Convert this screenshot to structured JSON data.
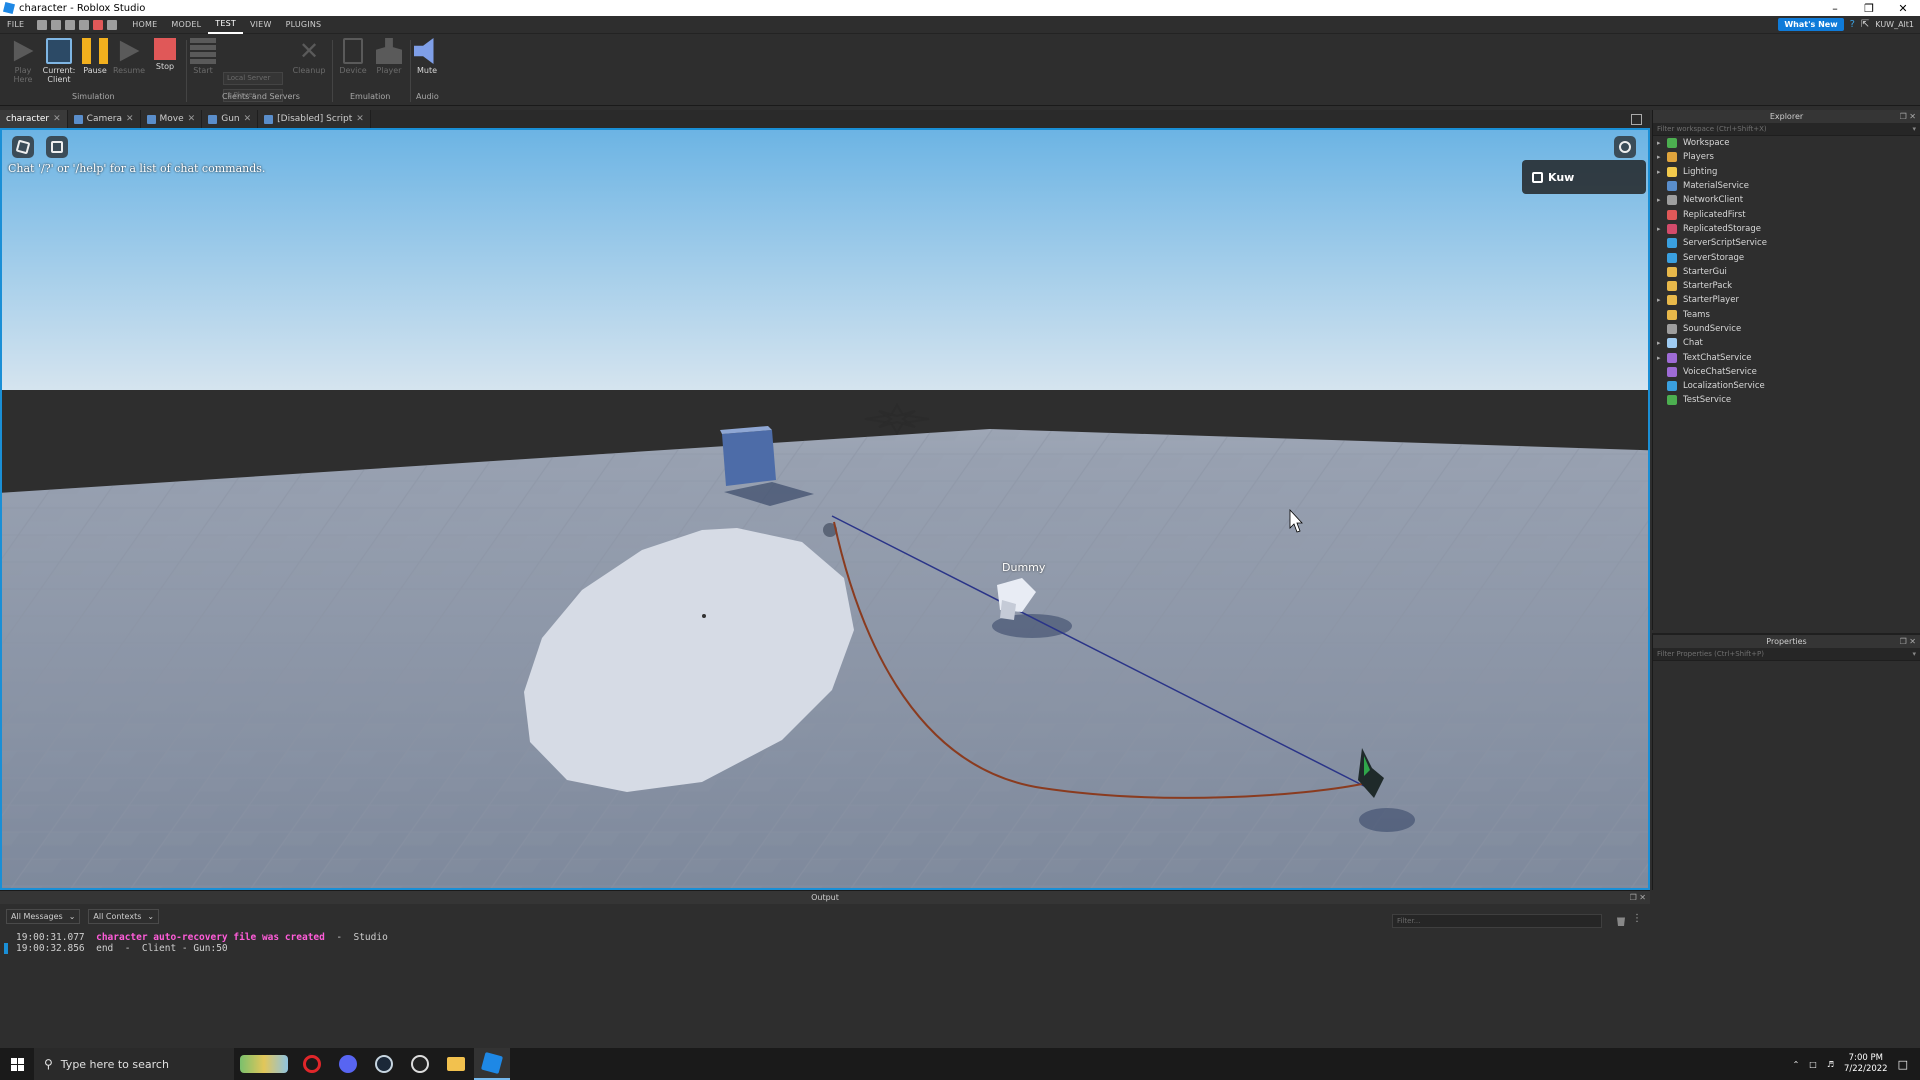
{
  "window": {
    "title": "character - Roblox Studio",
    "controls": [
      "–",
      "❐",
      "✕"
    ]
  },
  "menu": {
    "items": [
      "FILE",
      "HOME",
      "MODEL",
      "TEST",
      "VIEW",
      "PLUGINS"
    ],
    "active": "TEST",
    "whats_new": "What's New",
    "user": "KUW_Alt1"
  },
  "ribbon": {
    "play_here": "Play Here",
    "current_client": "Current: Client",
    "pause": "Pause",
    "resume": "Resume",
    "stop": "Stop",
    "start": "Start",
    "local_server": "Local Server",
    "player_count": "1 Player",
    "cleanup": "Cleanup",
    "device": "Device",
    "player": "Player",
    "mute": "Mute",
    "groups": [
      "Simulation",
      "Clients and Servers",
      "Emulation",
      "Audio"
    ]
  },
  "tabs": [
    {
      "label": "character"
    },
    {
      "label": "Camera"
    },
    {
      "label": "Move"
    },
    {
      "label": "Gun"
    },
    {
      "label": "[Disabled] Script"
    }
  ],
  "viewport": {
    "chat_hint": "Chat '/?' or '/help' for a list of chat commands.",
    "player_name": "Kuw",
    "dummy_label": "Dummy"
  },
  "explorer": {
    "title": "Explorer",
    "filter_placeholder": "Filter workspace (Ctrl+Shift+X)",
    "items": [
      {
        "label": "Workspace",
        "expandable": true,
        "icon": "globe-icon",
        "color": "#4caf50"
      },
      {
        "label": "Players",
        "expandable": true,
        "icon": "players-icon",
        "color": "#e0a43c"
      },
      {
        "label": "Lighting",
        "expandable": true,
        "icon": "bulb-icon",
        "color": "#f2c94c"
      },
      {
        "label": "MaterialService",
        "expandable": false,
        "icon": "material-icon",
        "color": "#5a8ecb"
      },
      {
        "label": "NetworkClient",
        "expandable": true,
        "icon": "network-icon",
        "color": "#9e9e9e"
      },
      {
        "label": "ReplicatedFirst",
        "expandable": false,
        "icon": "replicated-first-icon",
        "color": "#e05858"
      },
      {
        "label": "ReplicatedStorage",
        "expandable": true,
        "icon": "replicated-storage-icon",
        "color": "#d34b6b"
      },
      {
        "label": "ServerScriptService",
        "expandable": false,
        "icon": "server-script-icon",
        "color": "#3aa0e0"
      },
      {
        "label": "ServerStorage",
        "expandable": false,
        "icon": "server-storage-icon",
        "color": "#3aa0e0"
      },
      {
        "label": "StarterGui",
        "expandable": false,
        "icon": "folder-icon",
        "color": "#e8b84a"
      },
      {
        "label": "StarterPack",
        "expandable": false,
        "icon": "folder-icon",
        "color": "#e8b84a"
      },
      {
        "label": "StarterPlayer",
        "expandable": true,
        "icon": "folder-icon",
        "color": "#e8b84a"
      },
      {
        "label": "Teams",
        "expandable": false,
        "icon": "flag-icon",
        "color": "#e8b84a"
      },
      {
        "label": "SoundService",
        "expandable": false,
        "icon": "speaker-icon",
        "color": "#9e9e9e"
      },
      {
        "label": "Chat",
        "expandable": true,
        "icon": "chat-icon",
        "color": "#9ecbf2"
      },
      {
        "label": "TextChatService",
        "expandable": true,
        "icon": "text-chat-icon",
        "color": "#9e6bd6"
      },
      {
        "label": "VoiceChatService",
        "expandable": false,
        "icon": "voice-chat-icon",
        "color": "#9e6bd6"
      },
      {
        "label": "LocalizationService",
        "expandable": false,
        "icon": "localization-icon",
        "color": "#3aa0e0"
      },
      {
        "label": "TestService",
        "expandable": false,
        "icon": "check-icon",
        "color": "#4caf50"
      }
    ]
  },
  "properties": {
    "title": "Properties",
    "filter_placeholder": "Filter Properties (Ctrl+Shift+P)"
  },
  "output": {
    "title": "Output",
    "messages_filter": "All Messages",
    "contexts_filter": "All Contexts",
    "filter_placeholder": "Filter...",
    "lines": [
      {
        "time": "19:00:31.077",
        "message": "character auto-recovery file was created",
        "source": "  -  Studio"
      },
      {
        "time": "19:00:32.856",
        "message": "end",
        "source": "  -  Client - Gun:50"
      }
    ]
  },
  "taskbar": {
    "search_placeholder": "Type here to search",
    "time": "7:00 PM",
    "date": "7/22/2022"
  },
  "colors": {
    "accent": "#1a8fd6",
    "sky_top": "#6cb4e4",
    "baseplate": "#8c96a8",
    "auto_recovery_msg": "#ff5cd9"
  }
}
